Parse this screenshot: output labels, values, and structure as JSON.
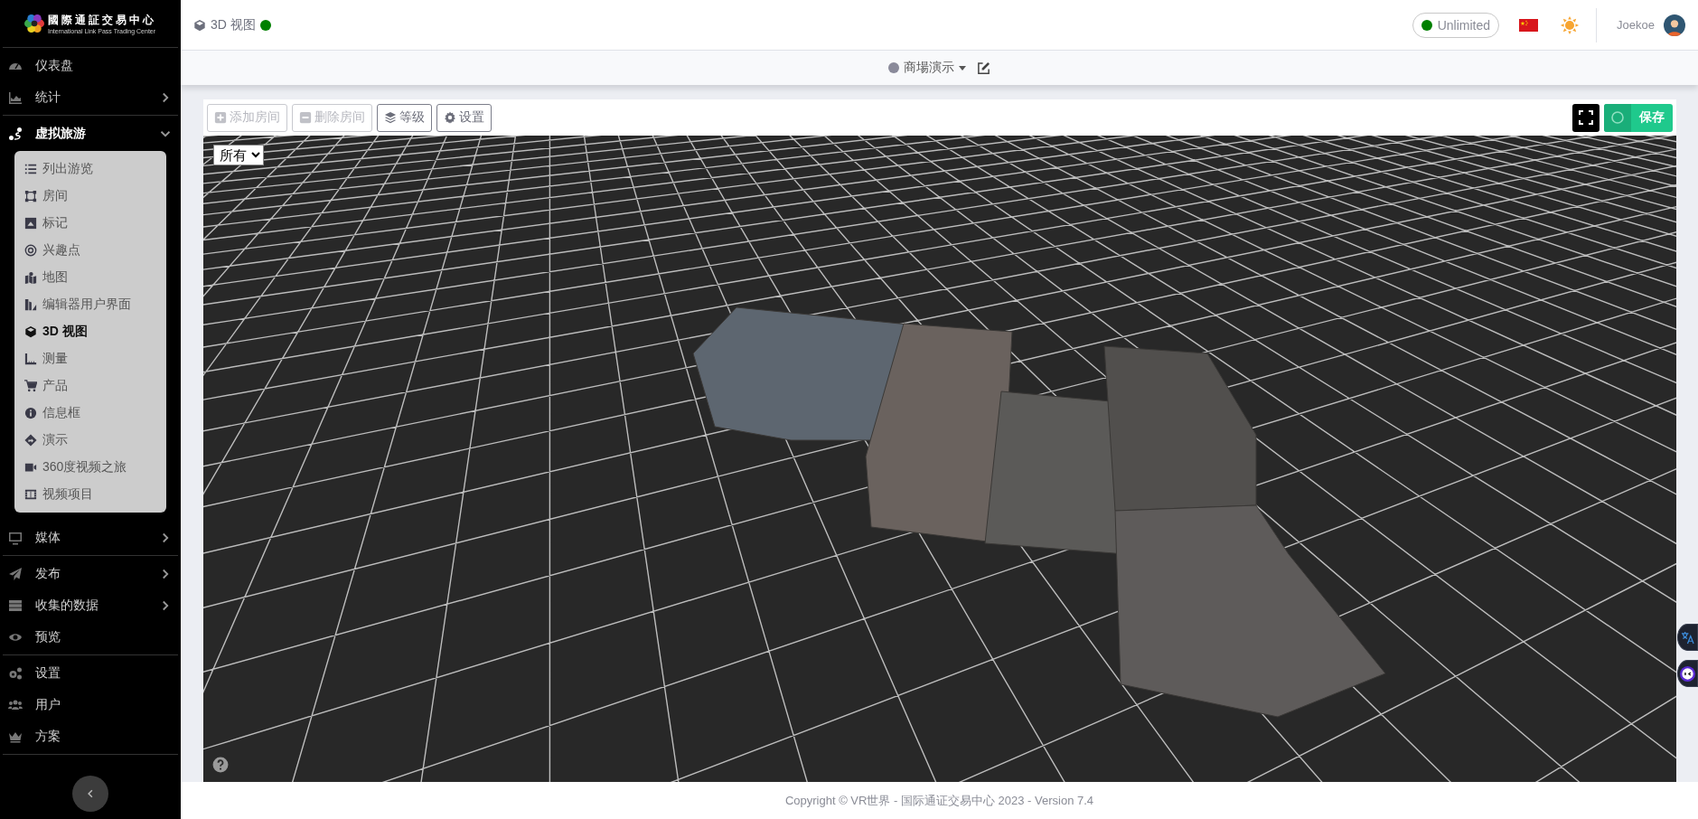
{
  "sidebar": {
    "logo": {
      "title": "國際通証交易中心",
      "subtitle": "International Link Pass Trading Center"
    },
    "sections": [
      {
        "items": [
          {
            "label": "仪表盘",
            "kind": "link"
          },
          {
            "label": "统计",
            "kind": "menu",
            "expanded": false
          }
        ]
      },
      {
        "items": [
          {
            "label": "虚拟旅游",
            "kind": "menu",
            "expanded": true,
            "children": [
              {
                "label": "列出游览",
                "selected": false
              },
              {
                "label": "房间",
                "selected": false
              },
              {
                "label": "标记",
                "selected": false
              },
              {
                "label": "兴趣点",
                "selected": false
              },
              {
                "label": "地图",
                "selected": false
              },
              {
                "label": "编辑器用户界面",
                "selected": false
              },
              {
                "label": "3D 视图",
                "selected": true
              },
              {
                "label": "测量",
                "selected": false
              },
              {
                "label": "产品",
                "selected": false
              },
              {
                "label": "信息框",
                "selected": false
              },
              {
                "label": "演示",
                "selected": false
              },
              {
                "label": "360度视频之旅",
                "selected": false
              },
              {
                "label": "视频项目",
                "selected": false
              }
            ]
          },
          {
            "label": "媒体",
            "kind": "menu",
            "expanded": false
          }
        ]
      },
      {
        "items": [
          {
            "label": "发布",
            "kind": "menu",
            "expanded": false
          },
          {
            "label": "收集的数据",
            "kind": "menu",
            "expanded": false
          },
          {
            "label": "预览",
            "kind": "link"
          }
        ]
      },
      {
        "items": [
          {
            "label": "设置",
            "kind": "link"
          },
          {
            "label": "用户",
            "kind": "link"
          },
          {
            "label": "方案",
            "kind": "link"
          }
        ]
      }
    ]
  },
  "header": {
    "page_title": "3D 视图",
    "live": true,
    "plan": {
      "label": "Unlimited",
      "active": true
    },
    "user": {
      "name": "Joekoe"
    }
  },
  "subbar": {
    "tour": "商場演示",
    "active": false
  },
  "toolbar": {
    "buttons": [
      {
        "label": "添加房间",
        "disabled": true
      },
      {
        "label": "删除房间",
        "disabled": true
      },
      {
        "label": "等级",
        "disabled": false
      },
      {
        "label": "设置",
        "disabled": false
      }
    ],
    "save": {
      "label": "保存"
    }
  },
  "viewport": {
    "level_select": {
      "value": "所有"
    }
  },
  "footer": {
    "text": "Copyright © VR世界 - 国际通证交易中心 2023 - Version 7.4"
  }
}
